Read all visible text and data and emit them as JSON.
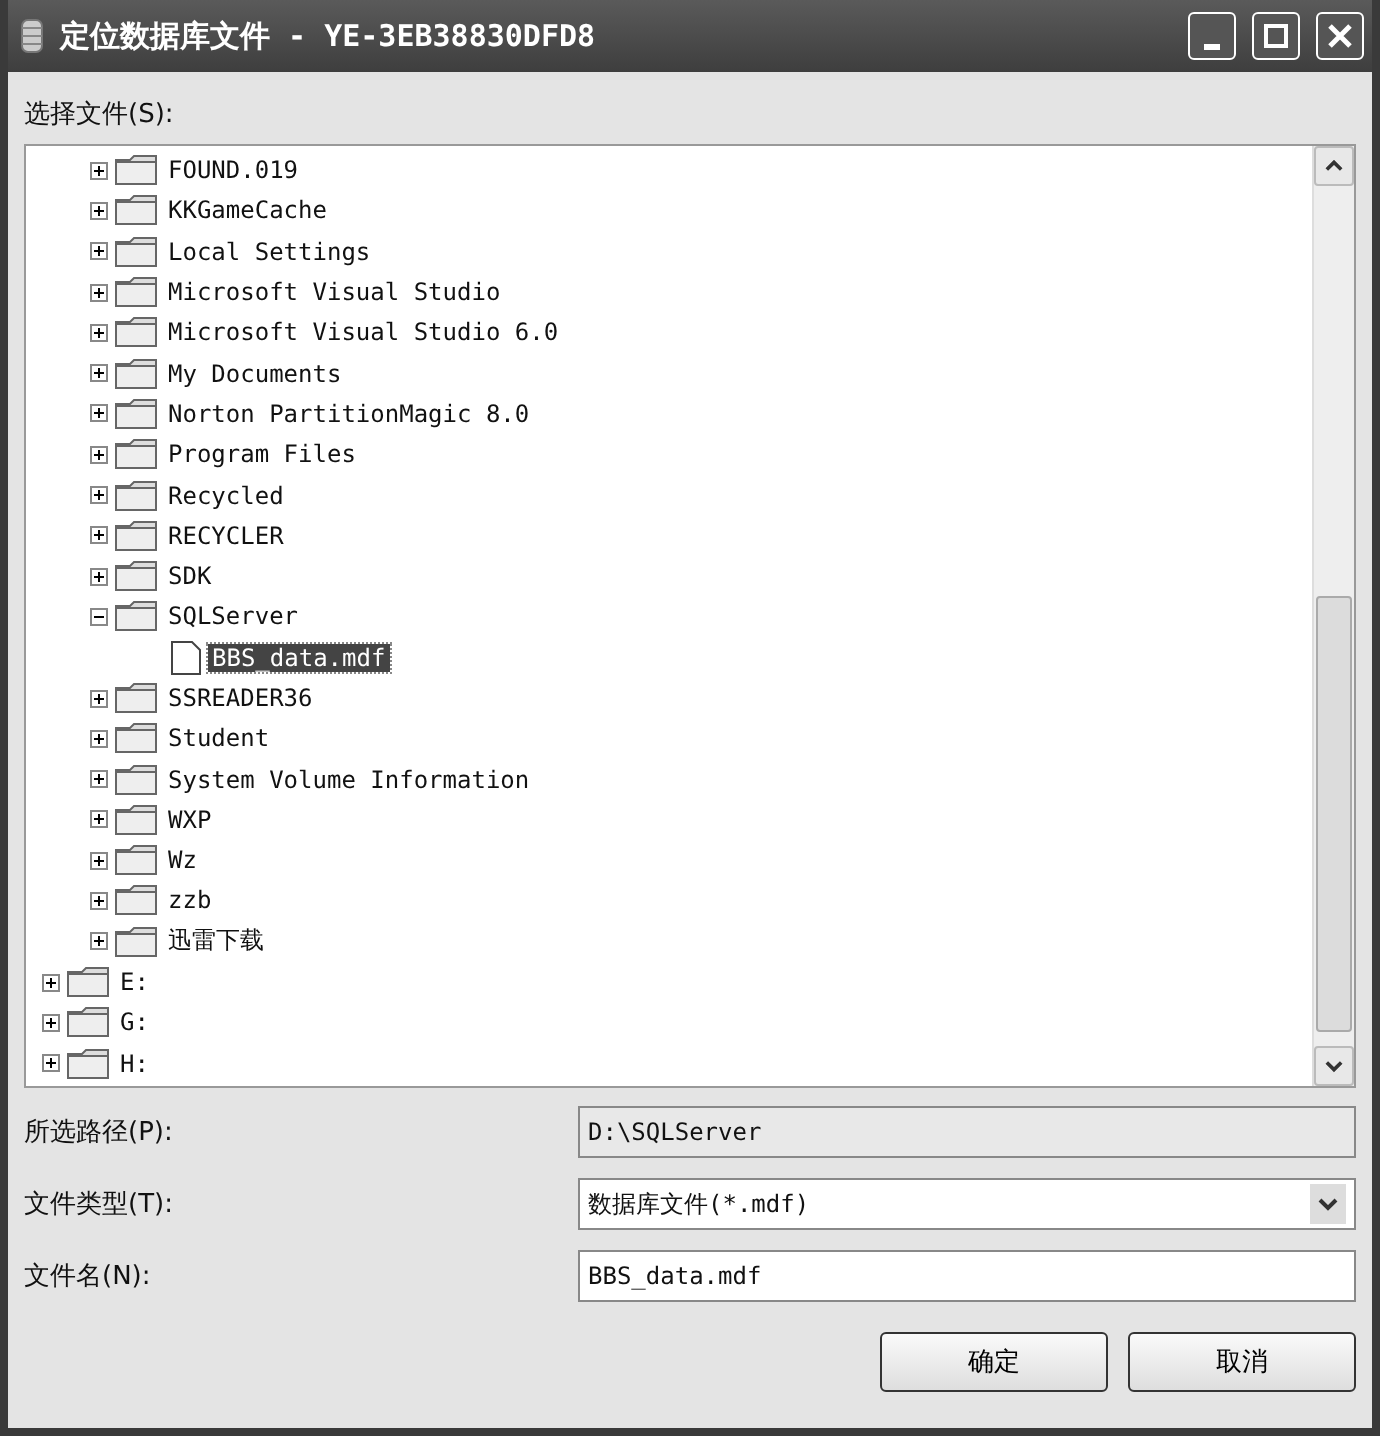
{
  "window": {
    "title": "定位数据库文件 - YE-3EB38830DFD8"
  },
  "tree_label": "选择文件(S):",
  "tree": {
    "items": [
      {
        "children": [
          {
            "label": "FOUND.019",
            "kind": "folder",
            "expanded": false,
            "selected": false
          },
          {
            "label": "KKGameCache",
            "kind": "folder",
            "expanded": false,
            "selected": false
          },
          {
            "label": "Local Settings",
            "kind": "folder",
            "expanded": false,
            "selected": false
          },
          {
            "label": "Microsoft Visual Studio",
            "kind": "folder",
            "expanded": false,
            "selected": false
          },
          {
            "label": "Microsoft Visual Studio 6.0",
            "kind": "folder",
            "expanded": false,
            "selected": false
          },
          {
            "label": "My Documents",
            "kind": "folder",
            "expanded": false,
            "selected": false
          },
          {
            "label": "Norton PartitionMagic 8.0",
            "kind": "folder",
            "expanded": false,
            "selected": false
          },
          {
            "label": "Program Files",
            "kind": "folder",
            "expanded": false,
            "selected": false
          },
          {
            "label": "Recycled",
            "kind": "folder",
            "expanded": false,
            "selected": false
          },
          {
            "label": "RECYCLER",
            "kind": "folder",
            "expanded": false,
            "selected": false
          },
          {
            "label": "SDK",
            "kind": "folder",
            "expanded": false,
            "selected": false
          },
          {
            "label": "SQLServer",
            "kind": "folder",
            "expanded": true,
            "selected": false,
            "children": [
              {
                "label": "BBS_data.mdf",
                "kind": "file",
                "selected": true
              }
            ]
          },
          {
            "label": "SSREADER36",
            "kind": "folder",
            "expanded": false,
            "selected": false
          },
          {
            "label": "Student",
            "kind": "folder",
            "expanded": false,
            "selected": false
          },
          {
            "label": "System Volume Information",
            "kind": "folder",
            "expanded": false,
            "selected": false
          },
          {
            "label": "WXP",
            "kind": "folder",
            "expanded": false,
            "selected": false
          },
          {
            "label": "Wz",
            "kind": "folder",
            "expanded": false,
            "selected": false
          },
          {
            "label": "zzb",
            "kind": "folder",
            "expanded": false,
            "selected": false
          },
          {
            "label": "迅雷下载",
            "kind": "folder",
            "expanded": false,
            "selected": false
          }
        ]
      },
      {
        "label": "E:",
        "kind": "folder",
        "expanded": false,
        "selected": false
      },
      {
        "label": "G:",
        "kind": "folder",
        "expanded": false,
        "selected": false
      },
      {
        "label": "H:",
        "kind": "folder",
        "expanded": false,
        "selected": false
      }
    ]
  },
  "fields": [
    {
      "label": "所选路径(P):",
      "kind": "readonly",
      "value": "D:\\SQLServer"
    },
    {
      "label": "文件类型(T):",
      "kind": "dropdown",
      "value": "数据库文件(*.mdf)"
    },
    {
      "label": "文件名(N):",
      "kind": "text",
      "value": "BBS_data.mdf"
    }
  ],
  "buttons": [
    "确定",
    "取消"
  ]
}
